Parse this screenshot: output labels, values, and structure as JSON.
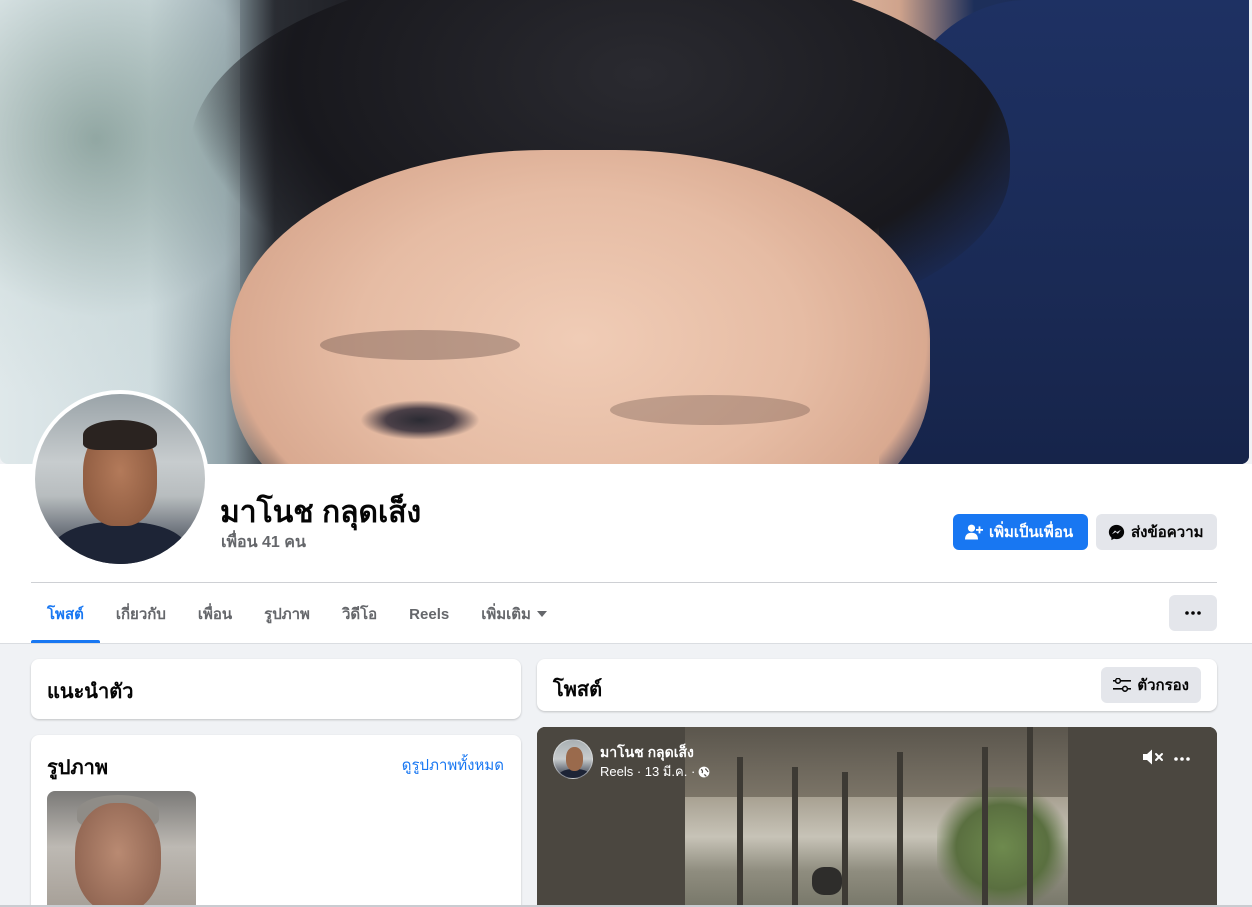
{
  "profile": {
    "name": "มาโนช กลุดเส็ง",
    "friends_count": "เพื่อน 41 คน",
    "add_friend_label": "เพิ่มเป็นเพื่อน",
    "message_label": "ส่งข้อความ"
  },
  "tabs": [
    {
      "label": "โพสต์",
      "active": true
    },
    {
      "label": "เกี่ยวกับ",
      "active": false
    },
    {
      "label": "เพื่อน",
      "active": false
    },
    {
      "label": "รูปภาพ",
      "active": false
    },
    {
      "label": "วิดีโอ",
      "active": false
    },
    {
      "label": "Reels",
      "active": false
    },
    {
      "label": "เพิ่มเติม",
      "active": false
    }
  ],
  "intro": {
    "title": "แนะนำตัว"
  },
  "photos": {
    "title": "รูปภาพ",
    "see_all": "ดูรูปภาพทั้งหมด"
  },
  "posts": {
    "title": "โพสต์",
    "filter_label": "ตัวกรอง"
  },
  "reel_post": {
    "author": "มาโนช กลุดเส็ง",
    "meta": "Reels · 13 มี.ค. ·",
    "privacy_icon": "globe-icon",
    "mute_icon": "speaker-muted-icon"
  },
  "colors": {
    "accent": "#1877f2",
    "background": "#f0f2f5",
    "secondary_button": "#e4e6eb"
  }
}
